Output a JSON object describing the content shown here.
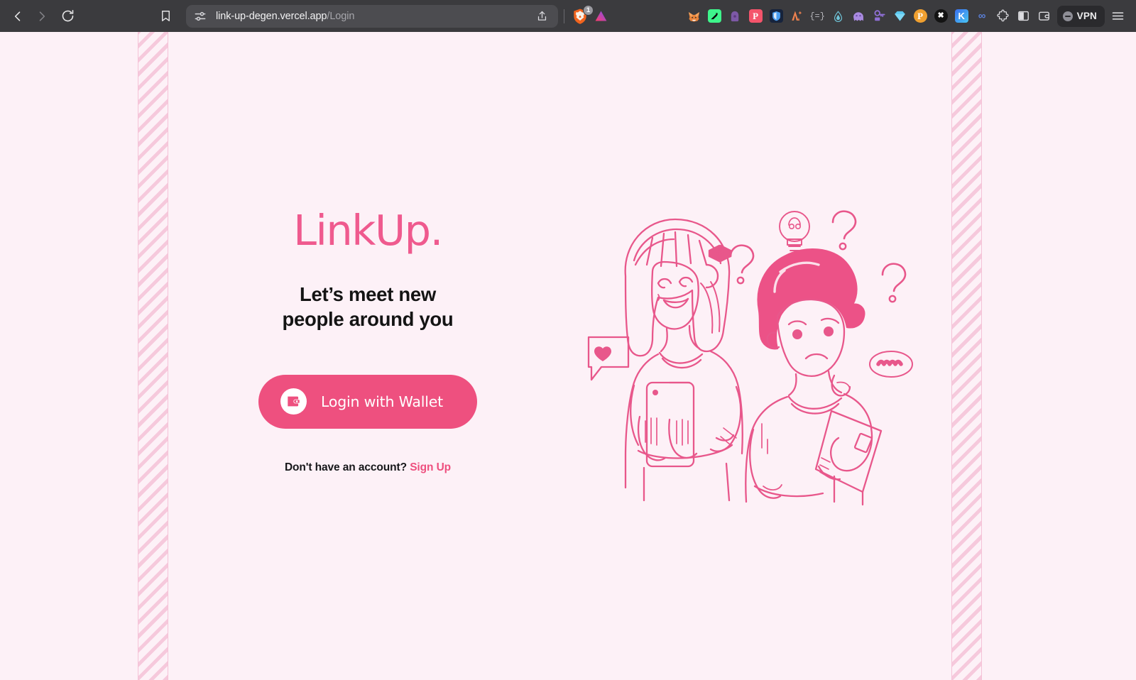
{
  "browser": {
    "back_icon": "chevron-left-icon",
    "forward_icon": "chevron-right-icon",
    "reload_icon": "reload-icon",
    "bookmark_icon": "bookmark-icon",
    "tune_icon": "sliders-icon",
    "share_icon": "share-upload-icon",
    "url_domain": "link-up-degen.vercel.app",
    "url_path": "/Login",
    "url_full": "link-up-degen.vercel.app/Login",
    "shield_badge_count": "1",
    "shield_icon": "brave-shield-lion-icon",
    "rewards_icon": "brave-rewards-triangle-icon",
    "vpn_label": "VPN",
    "menu_icon": "hamburger-menu-icon",
    "extensions": [
      {
        "name": "metamask-fox-icon",
        "glyph": "🦊",
        "bg": "transparent",
        "fg": "#e8833a"
      },
      {
        "name": "phantom-green-icon",
        "glyph": "◢",
        "bg": "#3ef58b",
        "fg": "#0a0a0a"
      },
      {
        "name": "keeper-lock-icon",
        "glyph": "●",
        "bg": "transparent",
        "fg": "#9b6bc4"
      },
      {
        "name": "pocket-icon",
        "glyph": "P",
        "bg": "#f4546b",
        "fg": "#ffffff"
      },
      {
        "name": "bitwarden-icon",
        "glyph": "◐",
        "bg": "#1b2a44",
        "fg": "#4b9ef0"
      },
      {
        "name": "arc-star-icon",
        "glyph": "人",
        "bg": "transparent",
        "fg": "#f2834f"
      },
      {
        "name": "braces-icon",
        "glyph": "{=}",
        "bg": "transparent",
        "fg": "#b9b9be"
      },
      {
        "name": "water-drop-icon",
        "glyph": "◆",
        "bg": "transparent",
        "fg": "#6fc4d8"
      },
      {
        "name": "ghost-icon",
        "glyph": "◑",
        "bg": "transparent",
        "fg": "#a98ae0"
      },
      {
        "name": "key-lock-icon",
        "glyph": "⚷",
        "bg": "transparent",
        "fg": "#8f6fd6"
      },
      {
        "name": "diamond-gem-icon",
        "glyph": "◆",
        "bg": "transparent",
        "fg": "#5ac8f0"
      },
      {
        "name": "p-circle-orange-icon",
        "glyph": "P",
        "bg": "#f0a030",
        "fg": "#ffffff"
      },
      {
        "name": "x-black-circle-icon",
        "glyph": "✖",
        "bg": "#151515",
        "fg": "#ffffff"
      },
      {
        "name": "k-blue-icon",
        "glyph": "K",
        "bg": "#2f7bf0",
        "fg": "#ffffff"
      },
      {
        "name": "infinity-icon",
        "glyph": "∞",
        "bg": "transparent",
        "fg": "#5a7fd6"
      },
      {
        "name": "puzzle-extensions-icon",
        "glyph": "❖",
        "bg": "transparent",
        "fg": "#d8d8dc"
      },
      {
        "name": "sidebar-panel-icon",
        "glyph": "▧",
        "bg": "transparent",
        "fg": "#d8d8dc"
      },
      {
        "name": "wallet-chrome-icon",
        "glyph": "▤",
        "bg": "transparent",
        "fg": "#d8d8dc"
      }
    ]
  },
  "page": {
    "brand": "LinkUp.",
    "tagline_line1": "Let’s meet new",
    "tagline_line2": "people around you",
    "login_button_label": "Login with Wallet",
    "wallet_icon": "wallet-icon",
    "signup_prompt": "Don't have an account?",
    "signup_link": "Sign Up",
    "illustration_alt": "two-people-illustration",
    "colors": {
      "accent_pink": "#ee507f",
      "logo_pink": "#ef5a8e",
      "page_bg": "#fdf1f7",
      "stripe_pink": "#f6c9dc",
      "heading_dark": "#141414"
    }
  }
}
